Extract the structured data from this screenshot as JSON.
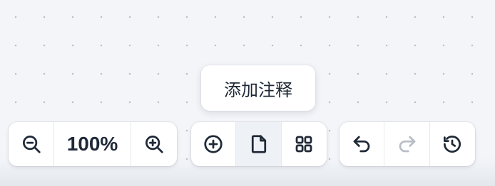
{
  "tooltip": {
    "text": "添加注释"
  },
  "zoom": {
    "level_text": "100%",
    "zoom_out_icon": "zoom-out-icon",
    "zoom_in_icon": "zoom-in-icon"
  },
  "tools": {
    "add_icon": "plus-circle-icon",
    "note_icon": "note-icon",
    "grid_icon": "grid-icon",
    "active_tool": "note"
  },
  "history": {
    "undo_icon": "undo-icon",
    "redo_icon": "redo-icon",
    "redo_enabled": false,
    "history_icon": "history-icon"
  },
  "colors": {
    "background": "#f3f5f9",
    "text": "#1f2937",
    "disabled": "#b8bec8",
    "active_bg": "#eef1f6"
  }
}
